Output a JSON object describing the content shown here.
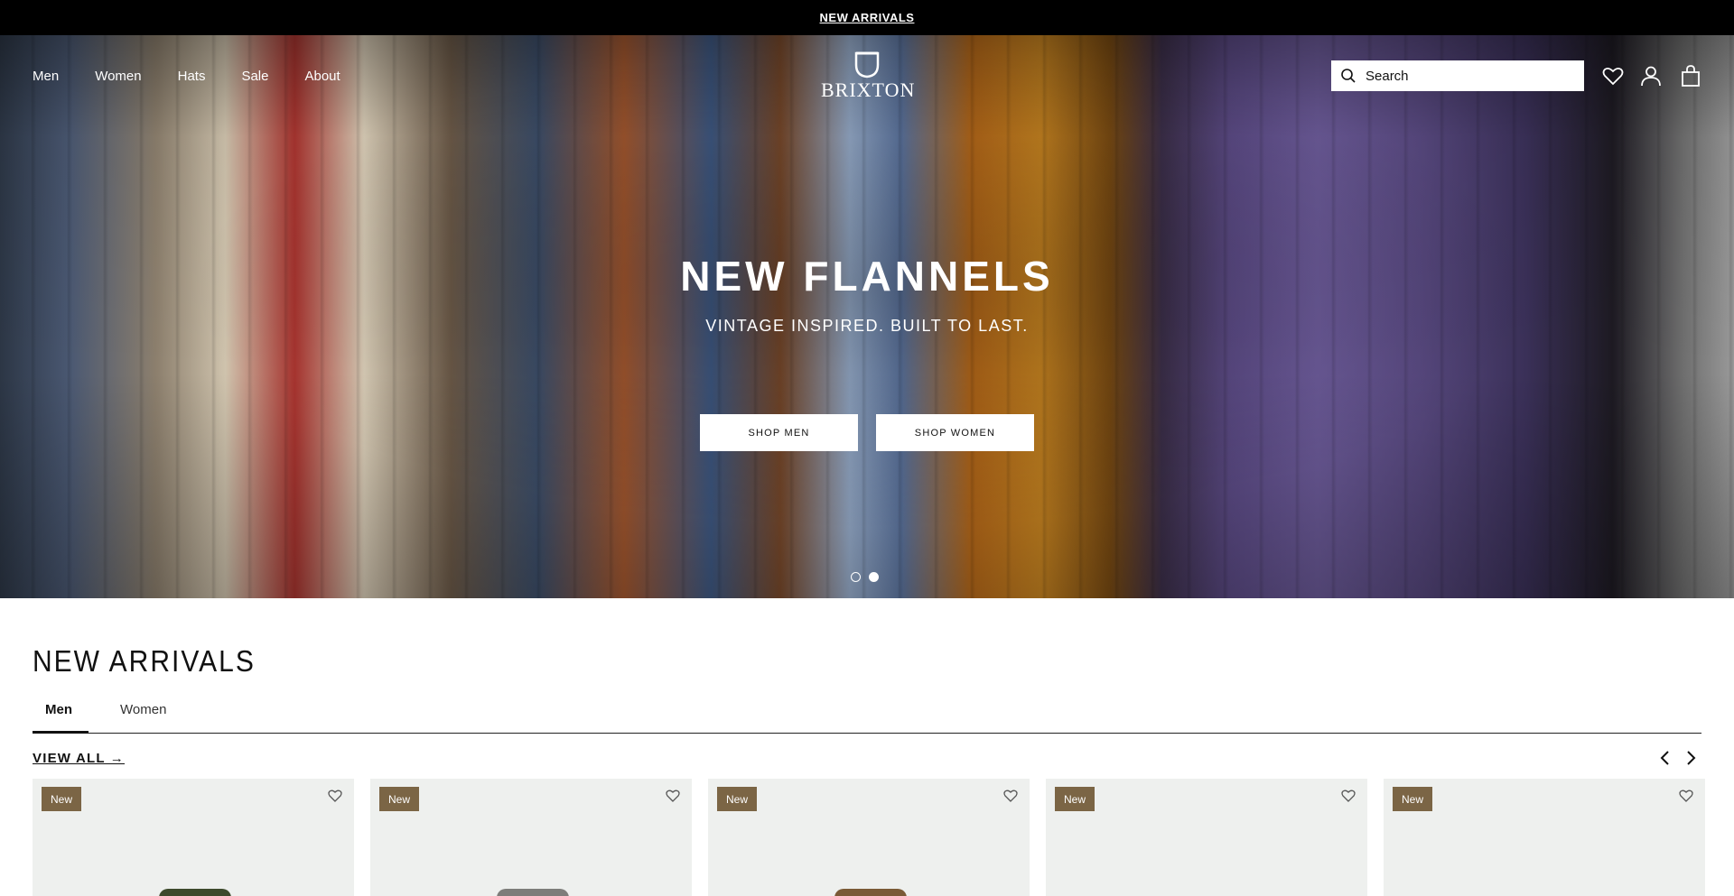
{
  "announcement": {
    "label": "NEW ARRIVALS"
  },
  "nav": {
    "items": [
      "Men",
      "Women",
      "Hats",
      "Sale",
      "About"
    ]
  },
  "brand": {
    "name": "BRIXTON"
  },
  "search": {
    "placeholder": "Search"
  },
  "header_icons": [
    "heart-icon",
    "user-icon",
    "bag-icon"
  ],
  "hero": {
    "title": "NEW FLANNELS",
    "subtitle": "VINTAGE INSPIRED. BUILT TO LAST.",
    "buttons": [
      "SHOP MEN",
      "SHOP WOMEN"
    ],
    "slides": {
      "count": 2,
      "active_index": 1
    }
  },
  "new_arrivals": {
    "title": "NEW ARRIVALS",
    "tabs": [
      {
        "label": "Men",
        "active": true
      },
      {
        "label": "Women",
        "active": false
      }
    ],
    "view_all": "VIEW ALL →",
    "products": [
      {
        "badge": "New",
        "color": "#3d4a2c"
      },
      {
        "badge": "New",
        "color": "#7d7d7a"
      },
      {
        "badge": "New",
        "color": "#7a5a36"
      },
      {
        "badge": "New",
        "color": "#eef0ee"
      },
      {
        "badge": "New",
        "color": "#eef0ee"
      }
    ]
  },
  "colors": {
    "announcement_bg": "#000000",
    "badge_bg": "#7b6545",
    "card_bg": "#eef0ee"
  }
}
